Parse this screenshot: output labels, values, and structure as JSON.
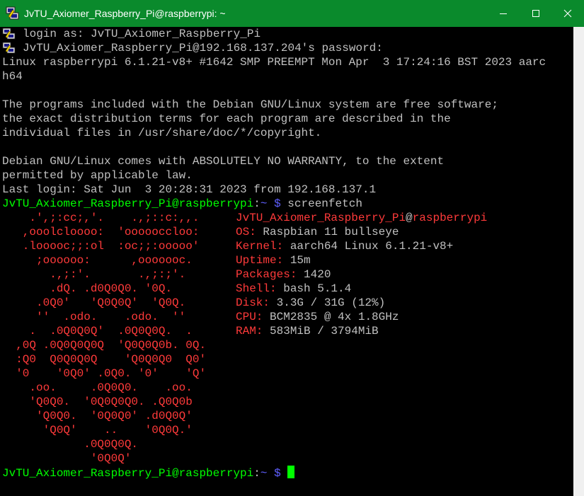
{
  "window": {
    "title": "JvTU_Axiomer_Raspberry_Pi@raspberrypi: ~",
    "accent": "#0a8a2c",
    "icons": [
      "putty-icon",
      "minimize-icon",
      "maximize-icon",
      "close-icon"
    ]
  },
  "terminal": {
    "colors": {
      "background": "#000000",
      "text": "#c0c0c0",
      "prompt": "#00ff00",
      "path": "#5f5fff",
      "art": "#ff3a3a"
    },
    "login_line": "login as: JvTU_Axiomer_Raspberry_Pi",
    "password_line": "JvTU_Axiomer_Raspberry_Pi@192.168.137.204's password:",
    "uname_line_1": "Linux raspberrypi 6.1.21-v8+ #1642 SMP PREEMPT Mon Apr  3 17:24:16 BST 2023 aarc",
    "uname_line_2": "h64",
    "motd": [
      "The programs included with the Debian GNU/Linux system are free software;",
      "the exact distribution terms for each program are described in the",
      "individual files in /usr/share/doc/*/copyright.",
      "",
      "Debian GNU/Linux comes with ABSOLUTELY NO WARRANTY, to the extent",
      "permitted by applicable law."
    ],
    "last_login": "Last login: Sat Jun  3 20:28:31 2023 from 192.168.137.1",
    "prompt": {
      "user_host": "JvTU_Axiomer_Raspberry_Pi@raspberrypi",
      "colon": ":",
      "path": "~",
      "symbol": " $ "
    },
    "command": "screenfetch",
    "logo": [
      "    .',;:cc;,'.    .,;::c:,,.   ",
      "   ,ooolcloooo:  'oooooccloo:   ",
      "   .looooc;;:ol  :oc;;:ooooo'   ",
      "     ;oooooo:      ,ooooooc.    ",
      "       .,;:'.       .,;:;'.     ",
      "       .dQ. .d0Q0Q0. '0Q.      ",
      "     .0Q0'   'Q0Q0Q'  'Q0Q.    ",
      "     ''  .odo.    .odo.  ''     ",
      "    .  .0Q0Q0Q'  .0Q0Q0Q.  .   ",
      "  ,0Q .0Q0Q0Q0Q  'Q0Q0Q0b. 0Q. ",
      "  :Q0  Q0Q0Q0Q    'Q0Q0Q0  Q0' ",
      "  '0    '0Q0' .0Q0. '0'    'Q' ",
      "    .oo.     .0Q0Q0.    .oo.    ",
      "    'Q0Q0.  '0Q0Q0Q0. .Q0Q0b    ",
      "     'Q0Q0.  '0Q0Q0' .d0Q0Q'    ",
      "      'Q0Q'    ..    '0Q0Q.'    ",
      "            .0Q0Q0Q.            ",
      "             '0Q0Q'             "
    ],
    "info_user_host": {
      "user": "JvTU_Axiomer_Raspberry_Pi",
      "at": "@",
      "host": "raspberrypi"
    },
    "info": [
      {
        "key": "OS: ",
        "value": "Raspbian 11 bullseye"
      },
      {
        "key": "Kernel: ",
        "value": "aarch64 Linux 6.1.21-v8+"
      },
      {
        "key": "Uptime: ",
        "value": "15m"
      },
      {
        "key": "Packages: ",
        "value": "1420"
      },
      {
        "key": "Shell: ",
        "value": "bash 5.1.4"
      },
      {
        "key": "Disk: ",
        "value": "3.3G / 31G (12%)"
      },
      {
        "key": "CPU: ",
        "value": "BCM2835 @ 4x 1.8GHz"
      },
      {
        "key": "RAM: ",
        "value": "583MiB / 3794MiB"
      }
    ]
  }
}
